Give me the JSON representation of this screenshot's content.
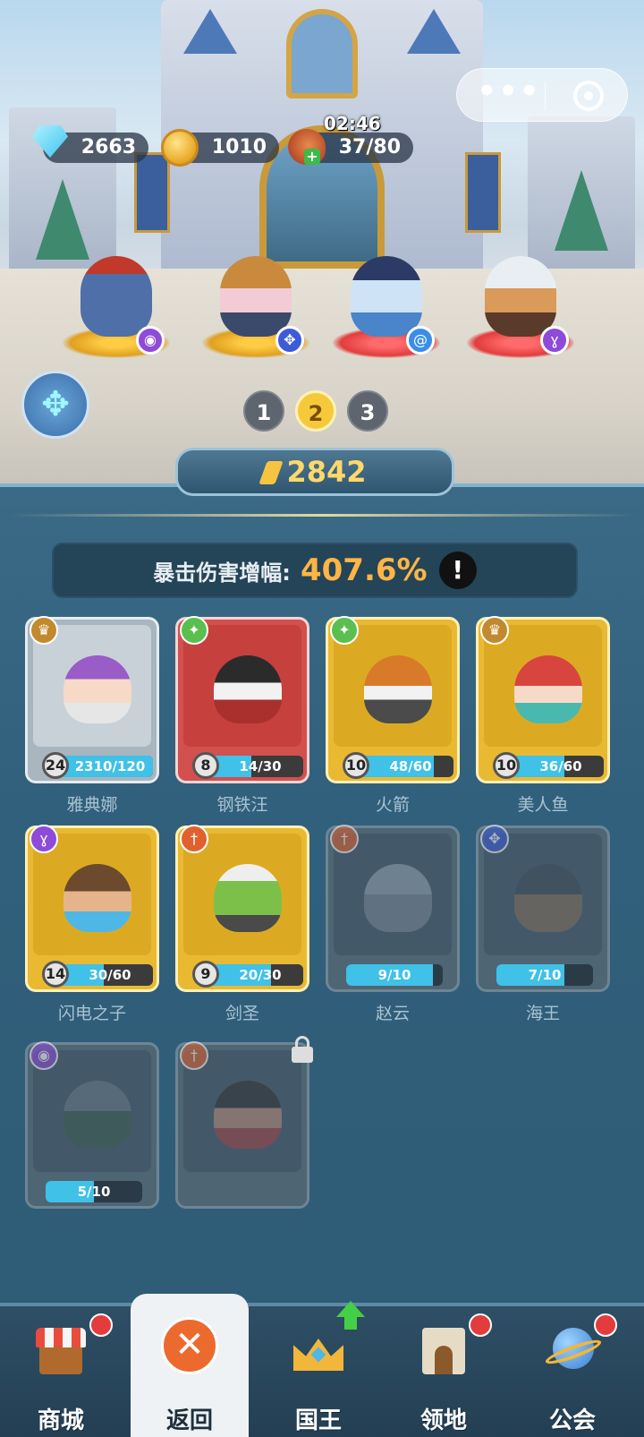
{
  "resources": {
    "gems": "2663",
    "gold": "1010",
    "stamina": "37/80",
    "stamina_timer": "02:46",
    "stamina_add": "+"
  },
  "capsule": {
    "more": "•••",
    "close_icon": "target-circle"
  },
  "team_pages": [
    "1",
    "2",
    "3"
  ],
  "active_page": "2",
  "power": "2842",
  "crit": {
    "label": "暴击伤害增幅:",
    "value": "407.6%",
    "info": "!"
  },
  "heroes": [
    {
      "name": "雅典娜",
      "level": "24",
      "progress": "2310/120",
      "fill": 1.0,
      "rarity": "grey",
      "class_icon": "crown-icon"
    },
    {
      "name": "钢铁汪",
      "level": "8",
      "progress": "14/30",
      "fill": 0.47,
      "rarity": "red",
      "class_icon": "sparkle-icon"
    },
    {
      "name": "火箭",
      "level": "10",
      "progress": "48/60",
      "fill": 0.8,
      "rarity": "gold",
      "class_icon": "sparkle-icon"
    },
    {
      "name": "美人鱼",
      "level": "10",
      "progress": "36/60",
      "fill": 0.6,
      "rarity": "gold",
      "class_icon": "crown-icon"
    },
    {
      "name": "闪电之子",
      "level": "14",
      "progress": "30/60",
      "fill": 0.5,
      "rarity": "gold",
      "class_icon": "staff-icon"
    },
    {
      "name": "剑圣",
      "level": "9",
      "progress": "20/30",
      "fill": 0.67,
      "rarity": "gold",
      "class_icon": "sword-icon"
    },
    {
      "name": "赵云",
      "level": "",
      "progress": "9/10",
      "fill": 0.9,
      "rarity": "locked",
      "class_icon": "sword-icon"
    },
    {
      "name": "海王",
      "level": "",
      "progress": "7/10",
      "fill": 0.7,
      "rarity": "locked",
      "class_icon": "paw-icon"
    },
    {
      "name": "",
      "level": "",
      "progress": "5/10",
      "fill": 0.5,
      "rarity": "locked",
      "class_icon": "eye-icon"
    },
    {
      "name": "",
      "level": "",
      "progress": "",
      "fill": 0,
      "rarity": "locked",
      "class_icon": "sword-icon",
      "lock_icon": "padlock-icon"
    }
  ],
  "nav": [
    {
      "label": "商城",
      "icon": "shop-stall-icon",
      "badge": "red-dot"
    },
    {
      "label": "返回",
      "icon": "close-x-icon",
      "active": true
    },
    {
      "label": "国王",
      "icon": "crown-icon",
      "badge": "green-up-arrow"
    },
    {
      "label": "领地",
      "icon": "castle-icon",
      "badge": "red-dot"
    },
    {
      "label": "公会",
      "icon": "planet-icon",
      "badge": "red-dot"
    }
  ],
  "colors": {
    "panel": "#30607c",
    "accent_gold": "#ffb545",
    "progress_fill": "#3fc1e8",
    "rarity_red": "#d2504e",
    "rarity_gold": "#e9b932",
    "rarity_grey": "#a9b5bf"
  }
}
